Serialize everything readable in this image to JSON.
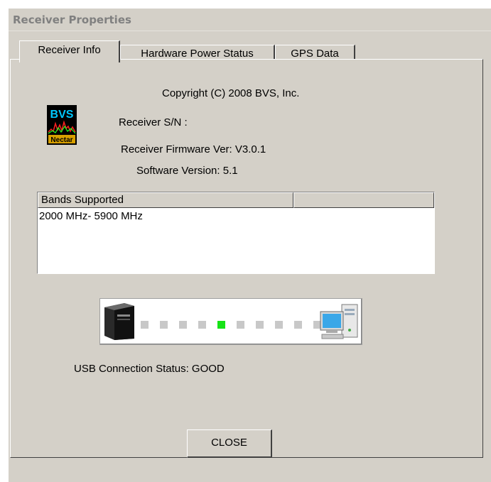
{
  "window": {
    "title": "Receiver Properties"
  },
  "tabs": [
    {
      "label": "Receiver Info",
      "active": true
    },
    {
      "label": "Hardware Power Status",
      "active": false
    },
    {
      "label": "GPS Data",
      "active": false
    }
  ],
  "info": {
    "copyright": "Copyright (C) 2008 BVS, Inc.",
    "serial": "Receiver S/N :",
    "firmware": "Receiver Firmware Ver: V3.0.1",
    "software": "Software Version: 5.1"
  },
  "logo": {
    "line1": "BVS",
    "line2": "Nectar",
    "icon": "bvs-nectar-logo"
  },
  "bands": {
    "columns": [
      "Bands Supported",
      ""
    ],
    "rows": [
      "2000 MHz- 5900 MHz"
    ]
  },
  "usb": {
    "status": "USB Connection Status: GOOD",
    "led_count": 10,
    "active_led": 4,
    "led_on_color": "#16e316",
    "led_off_color": "#c8c8c8",
    "left_icon": "receiver-device-icon",
    "right_icon": "computer-icon"
  },
  "buttons": {
    "close": "CLOSE"
  }
}
